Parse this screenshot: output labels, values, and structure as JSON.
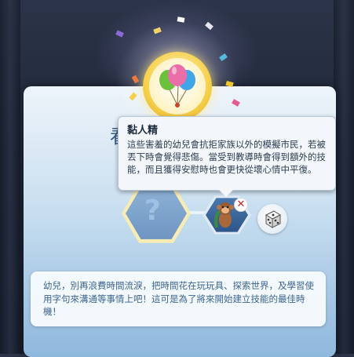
{
  "header": {
    "panel_title_partial": "看"
  },
  "tooltip": {
    "title": "黏人精",
    "body": "這些害羞的幼兒會抗拒家族以外的模擬市民，若被丟下時會覺得悲傷。當受到教導時會得到額外的技能，而且獲得安慰時也會更快從壞心情中平復。"
  },
  "skill_tree": {
    "empty_slot_symbol": "?",
    "selected_trait_name": "黏人精",
    "remove_symbol": "✕"
  },
  "description": {
    "text": "幼兒，別再浪費時間流淚，把時間花在玩玩具、探索世界，及學習使用字句來溝通等事情上吧！這可是為了將來開始建立技能的最佳時機！"
  },
  "icons": {
    "medallion": "balloons-icon",
    "trait": "monkey-plush-icon",
    "randomize": "dice-icon",
    "remove": "close-icon"
  },
  "colors": {
    "accent_blue": "#3c6490",
    "remove_red": "#c8262a",
    "medallion_gold": "#f6d04b"
  }
}
